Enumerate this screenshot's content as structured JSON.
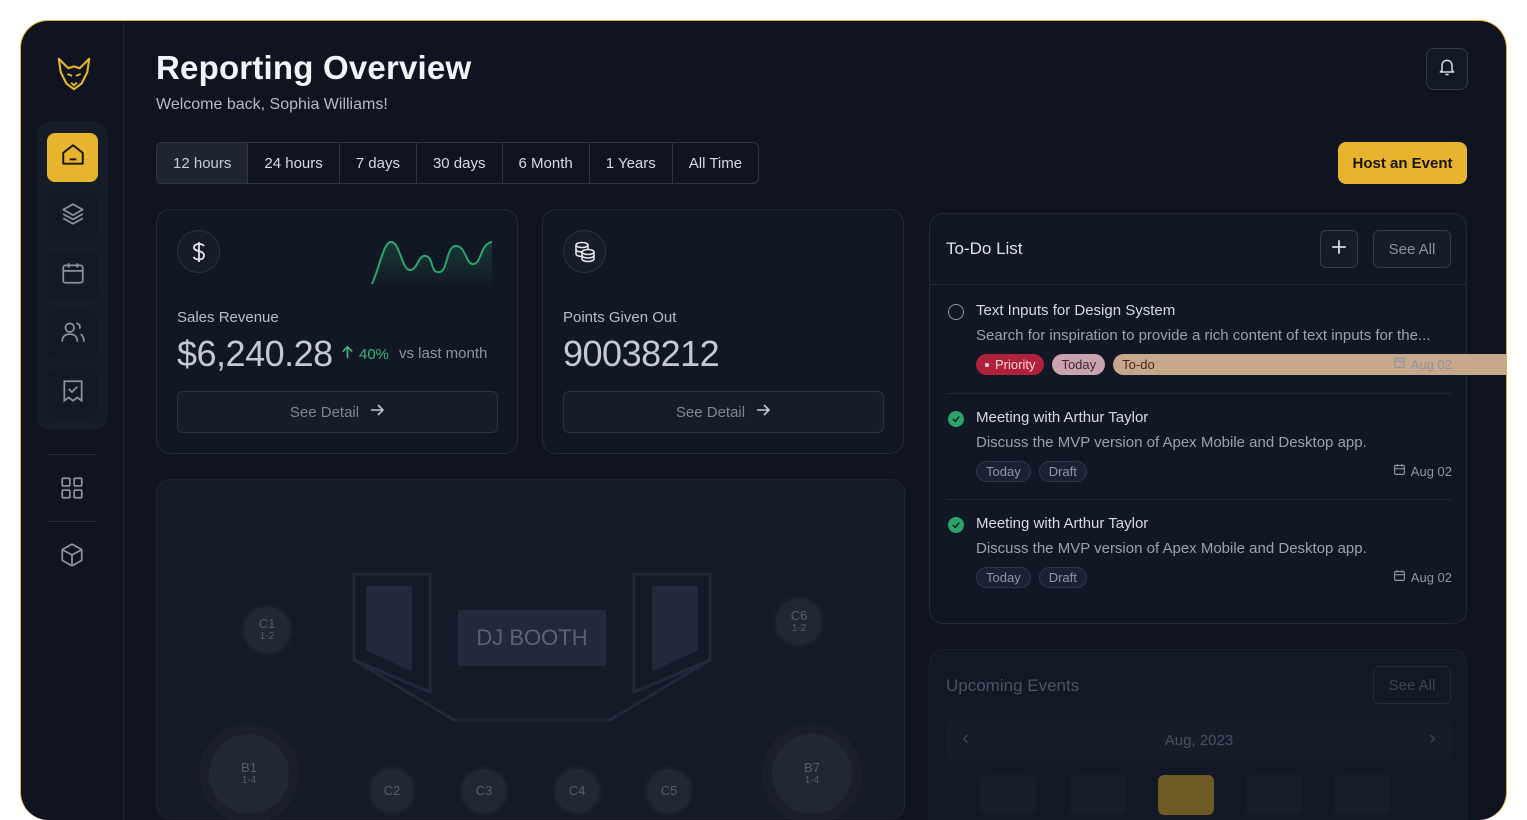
{
  "header": {
    "title": "Reporting Overview",
    "subtitle": "Welcome back, Sophia Williams!"
  },
  "range_tabs": [
    "12 hours",
    "24 hours",
    "7 days",
    "30 days",
    "6 Month",
    "1 Years",
    "All Time"
  ],
  "active_range": "12 hours",
  "host_button": "Host an Event",
  "colors": {
    "accent": "#e6b42f",
    "positive": "#3fb67d",
    "priority": "#b0213b",
    "background": "#0f1420"
  },
  "sidebar": {
    "items": [
      {
        "icon": "home-icon",
        "active": true
      },
      {
        "icon": "layers-icon",
        "active": false
      },
      {
        "icon": "calendar-icon",
        "active": false
      },
      {
        "icon": "users-icon",
        "active": false
      },
      {
        "icon": "checklist-icon",
        "active": false
      }
    ],
    "extra": [
      "grid-icon",
      "cube-icon"
    ]
  },
  "sales_card": {
    "label": "Sales Revenue",
    "value": "$6,240.28",
    "delta": "40%",
    "delta_note": "vs last month",
    "button": "See Detail"
  },
  "points_card": {
    "label": "Points Given Out",
    "value": "90038212",
    "button": "See Detail"
  },
  "floor_plan": {
    "booth": "DJ BOOTH",
    "tables": [
      {
        "name": "C1",
        "cap": "1-2"
      },
      {
        "name": "C6",
        "cap": "1-2"
      },
      {
        "name": "B1",
        "cap": "1-4"
      },
      {
        "name": "B7",
        "cap": "1-4"
      },
      {
        "name": "C2",
        "cap": ""
      },
      {
        "name": "C3",
        "cap": ""
      },
      {
        "name": "C4",
        "cap": ""
      },
      {
        "name": "C5",
        "cap": ""
      }
    ]
  },
  "todo": {
    "title": "To-Do List",
    "see_all": "See All",
    "tasks": [
      {
        "name": "Text Inputs for Design System",
        "desc": "Search for inspiration to provide a rich content of text inputs for the...",
        "done": false,
        "tags": [
          "Priority",
          "Today",
          "To-do"
        ],
        "date": "Aug 02"
      },
      {
        "name": "Meeting with Arthur Taylor",
        "desc": "Discuss the MVP version of Apex Mobile and Desktop app.",
        "done": true,
        "tags": [
          "Today",
          "Draft"
        ],
        "date": "Aug 02"
      },
      {
        "name": "Meeting with Arthur Taylor",
        "desc": "Discuss the MVP version of Apex Mobile and Desktop app.",
        "done": true,
        "tags": [
          "Today",
          "Draft"
        ],
        "date": "Aug 02"
      }
    ]
  },
  "upcoming": {
    "title": "Upcoming Events",
    "see_all": "See All",
    "month": "Aug, 2023"
  }
}
